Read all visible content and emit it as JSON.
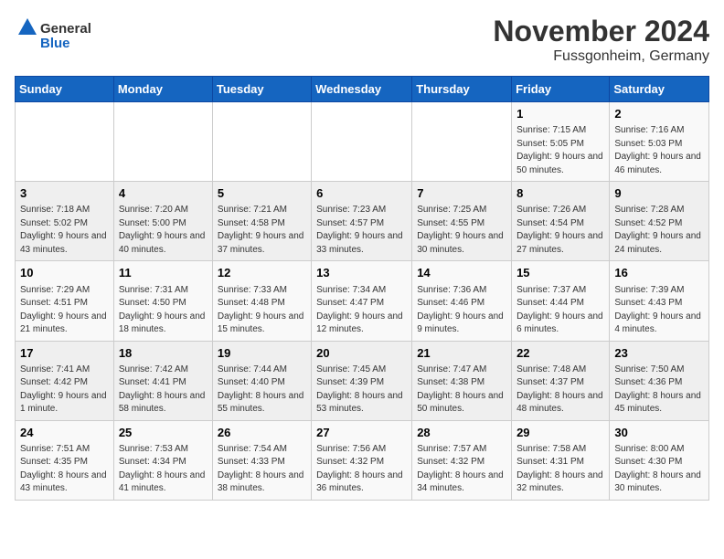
{
  "header": {
    "logo_general": "General",
    "logo_blue": "Blue",
    "month_title": "November 2024",
    "location": "Fussgonheim, Germany"
  },
  "weekdays": [
    "Sunday",
    "Monday",
    "Tuesday",
    "Wednesday",
    "Thursday",
    "Friday",
    "Saturday"
  ],
  "weeks": [
    [
      {
        "day": "",
        "info": ""
      },
      {
        "day": "",
        "info": ""
      },
      {
        "day": "",
        "info": ""
      },
      {
        "day": "",
        "info": ""
      },
      {
        "day": "",
        "info": ""
      },
      {
        "day": "1",
        "info": "Sunrise: 7:15 AM\nSunset: 5:05 PM\nDaylight: 9 hours and 50 minutes."
      },
      {
        "day": "2",
        "info": "Sunrise: 7:16 AM\nSunset: 5:03 PM\nDaylight: 9 hours and 46 minutes."
      }
    ],
    [
      {
        "day": "3",
        "info": "Sunrise: 7:18 AM\nSunset: 5:02 PM\nDaylight: 9 hours and 43 minutes."
      },
      {
        "day": "4",
        "info": "Sunrise: 7:20 AM\nSunset: 5:00 PM\nDaylight: 9 hours and 40 minutes."
      },
      {
        "day": "5",
        "info": "Sunrise: 7:21 AM\nSunset: 4:58 PM\nDaylight: 9 hours and 37 minutes."
      },
      {
        "day": "6",
        "info": "Sunrise: 7:23 AM\nSunset: 4:57 PM\nDaylight: 9 hours and 33 minutes."
      },
      {
        "day": "7",
        "info": "Sunrise: 7:25 AM\nSunset: 4:55 PM\nDaylight: 9 hours and 30 minutes."
      },
      {
        "day": "8",
        "info": "Sunrise: 7:26 AM\nSunset: 4:54 PM\nDaylight: 9 hours and 27 minutes."
      },
      {
        "day": "9",
        "info": "Sunrise: 7:28 AM\nSunset: 4:52 PM\nDaylight: 9 hours and 24 minutes."
      }
    ],
    [
      {
        "day": "10",
        "info": "Sunrise: 7:29 AM\nSunset: 4:51 PM\nDaylight: 9 hours and 21 minutes."
      },
      {
        "day": "11",
        "info": "Sunrise: 7:31 AM\nSunset: 4:50 PM\nDaylight: 9 hours and 18 minutes."
      },
      {
        "day": "12",
        "info": "Sunrise: 7:33 AM\nSunset: 4:48 PM\nDaylight: 9 hours and 15 minutes."
      },
      {
        "day": "13",
        "info": "Sunrise: 7:34 AM\nSunset: 4:47 PM\nDaylight: 9 hours and 12 minutes."
      },
      {
        "day": "14",
        "info": "Sunrise: 7:36 AM\nSunset: 4:46 PM\nDaylight: 9 hours and 9 minutes."
      },
      {
        "day": "15",
        "info": "Sunrise: 7:37 AM\nSunset: 4:44 PM\nDaylight: 9 hours and 6 minutes."
      },
      {
        "day": "16",
        "info": "Sunrise: 7:39 AM\nSunset: 4:43 PM\nDaylight: 9 hours and 4 minutes."
      }
    ],
    [
      {
        "day": "17",
        "info": "Sunrise: 7:41 AM\nSunset: 4:42 PM\nDaylight: 9 hours and 1 minute."
      },
      {
        "day": "18",
        "info": "Sunrise: 7:42 AM\nSunset: 4:41 PM\nDaylight: 8 hours and 58 minutes."
      },
      {
        "day": "19",
        "info": "Sunrise: 7:44 AM\nSunset: 4:40 PM\nDaylight: 8 hours and 55 minutes."
      },
      {
        "day": "20",
        "info": "Sunrise: 7:45 AM\nSunset: 4:39 PM\nDaylight: 8 hours and 53 minutes."
      },
      {
        "day": "21",
        "info": "Sunrise: 7:47 AM\nSunset: 4:38 PM\nDaylight: 8 hours and 50 minutes."
      },
      {
        "day": "22",
        "info": "Sunrise: 7:48 AM\nSunset: 4:37 PM\nDaylight: 8 hours and 48 minutes."
      },
      {
        "day": "23",
        "info": "Sunrise: 7:50 AM\nSunset: 4:36 PM\nDaylight: 8 hours and 45 minutes."
      }
    ],
    [
      {
        "day": "24",
        "info": "Sunrise: 7:51 AM\nSunset: 4:35 PM\nDaylight: 8 hours and 43 minutes."
      },
      {
        "day": "25",
        "info": "Sunrise: 7:53 AM\nSunset: 4:34 PM\nDaylight: 8 hours and 41 minutes."
      },
      {
        "day": "26",
        "info": "Sunrise: 7:54 AM\nSunset: 4:33 PM\nDaylight: 8 hours and 38 minutes."
      },
      {
        "day": "27",
        "info": "Sunrise: 7:56 AM\nSunset: 4:32 PM\nDaylight: 8 hours and 36 minutes."
      },
      {
        "day": "28",
        "info": "Sunrise: 7:57 AM\nSunset: 4:32 PM\nDaylight: 8 hours and 34 minutes."
      },
      {
        "day": "29",
        "info": "Sunrise: 7:58 AM\nSunset: 4:31 PM\nDaylight: 8 hours and 32 minutes."
      },
      {
        "day": "30",
        "info": "Sunrise: 8:00 AM\nSunset: 4:30 PM\nDaylight: 8 hours and 30 minutes."
      }
    ]
  ]
}
